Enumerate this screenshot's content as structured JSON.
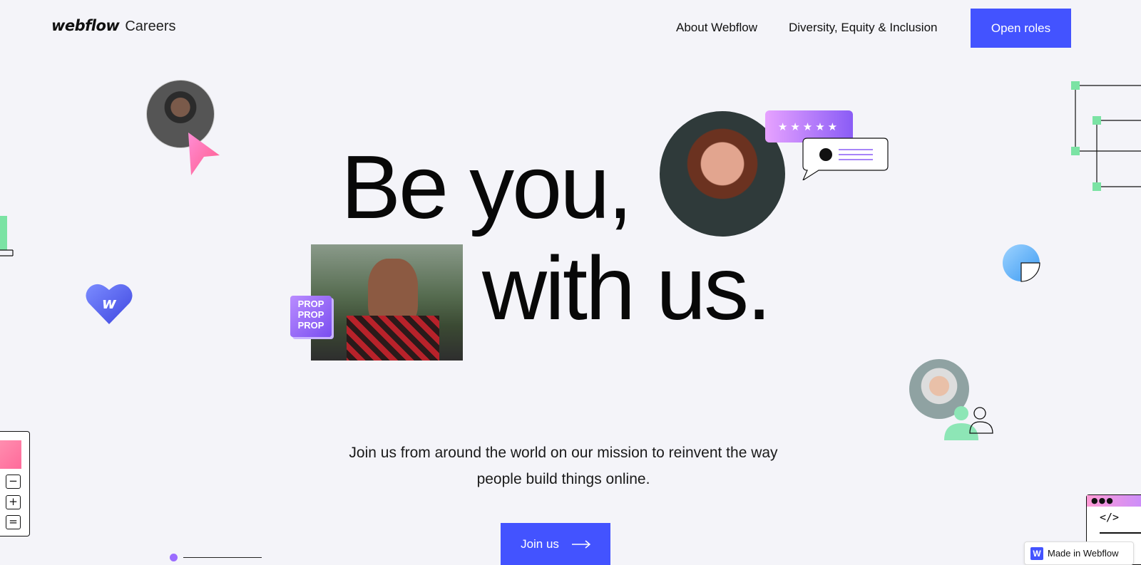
{
  "nav": {
    "logo_word": "webflow",
    "logo_suffix": "Careers",
    "links": [
      "About Webflow",
      "Diversity, Equity & Inclusion"
    ],
    "cta": "Open roles"
  },
  "hero": {
    "line1": "Be you,",
    "line2": "with us.",
    "subtext": "Join us from around the world on our mission to reinvent the way people build things online.",
    "button": "Join us",
    "rating_stars": "★★★★★",
    "prop_tag": "PROP PROP PROP",
    "heart_letter": "w"
  },
  "calc": {
    "buttons": [
      "−",
      "+",
      "="
    ]
  },
  "code_window": {
    "dots": "●●●",
    "tag": "</>"
  },
  "badge": {
    "letter": "W",
    "label": "Made in Webflow"
  },
  "colors": {
    "accent": "#4353ff",
    "background": "#f4f4f9",
    "purple": "#8a5cf6",
    "pink": "#ff6a9a",
    "green": "#7be3a4"
  },
  "icons": [
    "cursor-icon",
    "heart-logo-icon",
    "chat-bubble-icon",
    "pie-chart-icon",
    "user-icon",
    "arrow-right-icon",
    "code-icon"
  ]
}
